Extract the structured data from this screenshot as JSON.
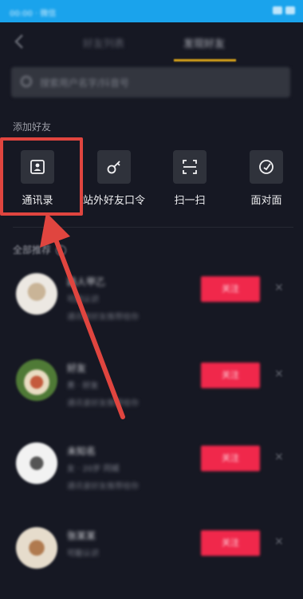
{
  "status_bar": {
    "left_text": "00:00 · 微信",
    "bg_color": "#1aa3ec"
  },
  "nav": {
    "back_icon": "back-chevron-icon",
    "tabs": [
      {
        "label": "好友列表",
        "active": false
      },
      {
        "label": "发现好友",
        "active": true
      }
    ],
    "accent": "#d7a21a"
  },
  "search": {
    "placeholder": "搜索用户名字/抖音号"
  },
  "add_friends": {
    "title": "添加好友",
    "items": [
      {
        "label": "通讯录",
        "icon": "contacts-icon"
      },
      {
        "label": "站外好友口令",
        "icon": "key-icon"
      },
      {
        "label": "扫一扫",
        "icon": "scan-icon"
      },
      {
        "label": "面对面",
        "icon": "face-to-face-icon"
      }
    ]
  },
  "recommend": {
    "title": "全部推荐",
    "info_icon": "info-icon",
    "follow_label": "关注",
    "close_icon": "close-x-icon",
    "users": [
      {
        "name": "路人甲乙",
        "sub": "可能认识",
        "desc": "通讯录好友推荐给你"
      },
      {
        "name": "好友",
        "sub": "男  · 好友",
        "desc": "通讯录好友推荐给你"
      },
      {
        "name": "未知名",
        "sub": "女 · 20岁  同城",
        "desc": "通讯录好友推荐给你"
      },
      {
        "name": "张某某",
        "sub": "可能认识",
        "desc": "通讯录好友推荐给你"
      }
    ]
  },
  "colors": {
    "background": "#161823",
    "follow_button": "#f0284b",
    "highlight": "#e0453f"
  }
}
